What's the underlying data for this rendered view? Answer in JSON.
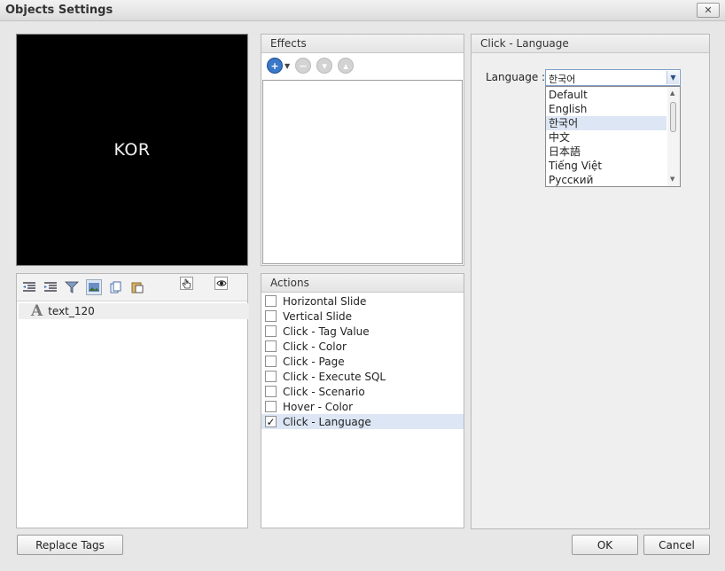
{
  "window": {
    "title": "Objects Settings",
    "close_glyph": "✕"
  },
  "preview": {
    "text": "KOR"
  },
  "tree": {
    "items": [
      {
        "icon": "A",
        "label": "text_120"
      }
    ]
  },
  "effects": {
    "header": "Effects"
  },
  "actions": {
    "header": "Actions",
    "items": [
      {
        "label": "Horizontal Slide",
        "checked": false
      },
      {
        "label": "Vertical Slide",
        "checked": false
      },
      {
        "label": "Click - Tag Value",
        "checked": false
      },
      {
        "label": "Click - Color",
        "checked": false
      },
      {
        "label": "Click - Page",
        "checked": false
      },
      {
        "label": "Click - Execute SQL",
        "checked": false
      },
      {
        "label": "Click - Scenario",
        "checked": false
      },
      {
        "label": "Hover - Color",
        "checked": false
      },
      {
        "label": "Click - Language",
        "checked": true,
        "check_glyph": "✓"
      }
    ]
  },
  "settings": {
    "header": "Click - Language",
    "language_label": "Language :",
    "language_value": "한국어",
    "options": [
      "Default",
      "English",
      "한국어",
      "中文",
      "日本語",
      "Tiếng Việt",
      "Русский"
    ],
    "selected_index": 2
  },
  "buttons": {
    "replace_tags": "Replace Tags",
    "ok": "OK",
    "cancel": "Cancel"
  },
  "colors": {
    "selection": "#dce6f4",
    "accent": "#2f6fc0",
    "preview_bg": "#000000"
  }
}
